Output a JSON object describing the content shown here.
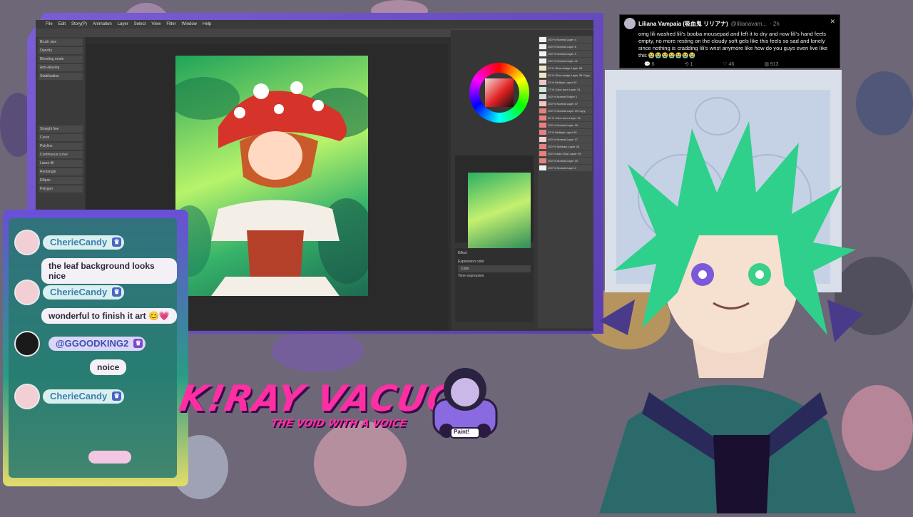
{
  "app": {
    "menu": [
      "File",
      "Edit",
      "Story(P)",
      "Animation",
      "Layer",
      "Select",
      "View",
      "Filter",
      "Window",
      "Help"
    ],
    "tool_rows": [
      "Brush size",
      "Opacity",
      "Blending mode",
      "Anti-aliasing",
      "Stabilization",
      "Straight line",
      "Curve",
      "Polyline",
      "Continuous curve",
      "Lasso fill",
      "Rectangle",
      "Ellipse",
      "Polygon"
    ],
    "layers": [
      {
        "name": "100 % Normal Layer 4",
        "color": "#f1f1f1"
      },
      {
        "name": "100 % Normal Layer 8",
        "color": "#f1f1f1"
      },
      {
        "name": "100 % Normal Layer 3",
        "color": "#f1f1f1"
      },
      {
        "name": "100 % Normal Layer 41",
        "color": "#f1f1f1"
      },
      {
        "name": "22 % Glow dodge Layer 33",
        "color": "#efe6c8"
      },
      {
        "name": "35 % Glow dodge Layer 35 Copy",
        "color": "#efe6c8"
      },
      {
        "name": "23 % Multiply Layer 32",
        "color": "#e9c8c8"
      },
      {
        "name": "17 % Color burn Layer 31",
        "color": "#c8e9d8"
      },
      {
        "name": "100 % Normal Folder 1",
        "color": "#dcdcdc"
      },
      {
        "name": "100 % Normal Layer 47",
        "color": "#f2c6c6"
      },
      {
        "name": "100 % Normal Layer 19 Copy",
        "color": "#e98080"
      },
      {
        "name": "32 % Color burn Layer 18",
        "color": "#e98080"
      },
      {
        "name": "100 % Normal Layer 16",
        "color": "#e98080"
      },
      {
        "name": "23 % Multiply Layer 30",
        "color": "#e98080"
      },
      {
        "name": "100 % Normal Layer 17",
        "color": "#f2d0d0"
      },
      {
        "name": "100 % Subtract Layer 28",
        "color": "#e98080"
      },
      {
        "name": "100 % Add Glow Layer 29",
        "color": "#e98080"
      },
      {
        "name": "100 % Normal Layer 15",
        "color": "#e98080"
      },
      {
        "name": "100 % Normal Layer 2",
        "color": "#f1f1f1"
      }
    ],
    "color_panel_label": "Expression color",
    "color_value": "Color",
    "tone_label": "Tone expression",
    "effect_label": "Effect"
  },
  "tweet": {
    "name": "Liliana Vampaia (吸血鬼 リリアナ)",
    "handle": "@lilianavam...",
    "time": "· 2h",
    "body": "omg lili washed lili's booba mousepad and left it to dry and now lili's hand feels empty, no more resting on the cloudy soft gels like this feels so sad and lonely since nothing is cradding lili's wrist anymore like how do you guys even live like this 😭😭😭😭😭😭😭",
    "stats": [
      "6",
      "1",
      "46",
      "913"
    ]
  },
  "chat": [
    {
      "user": "CherieCandy",
      "text": "the leaf background looks nice",
      "badge": "♛"
    },
    {
      "user": "CherieCandy",
      "text": "wonderful to finish it art 😊💗",
      "badge": "♛"
    },
    {
      "user": "@GGOODKING2",
      "text": "noice",
      "badge": "♛"
    },
    {
      "user": "CherieCandy",
      "text": "",
      "badge": "♛"
    }
  ],
  "branding": {
    "logo": "K!RAY VACUO",
    "tagline": "THE VOID WITH A VOICE",
    "mascot_label": "Paint!"
  },
  "colors": {
    "accent": "#ff2fa3",
    "frame_purple": "#6b4fd6",
    "chat_teal": "#2a9b86",
    "hair_green": "#2fd08b"
  }
}
